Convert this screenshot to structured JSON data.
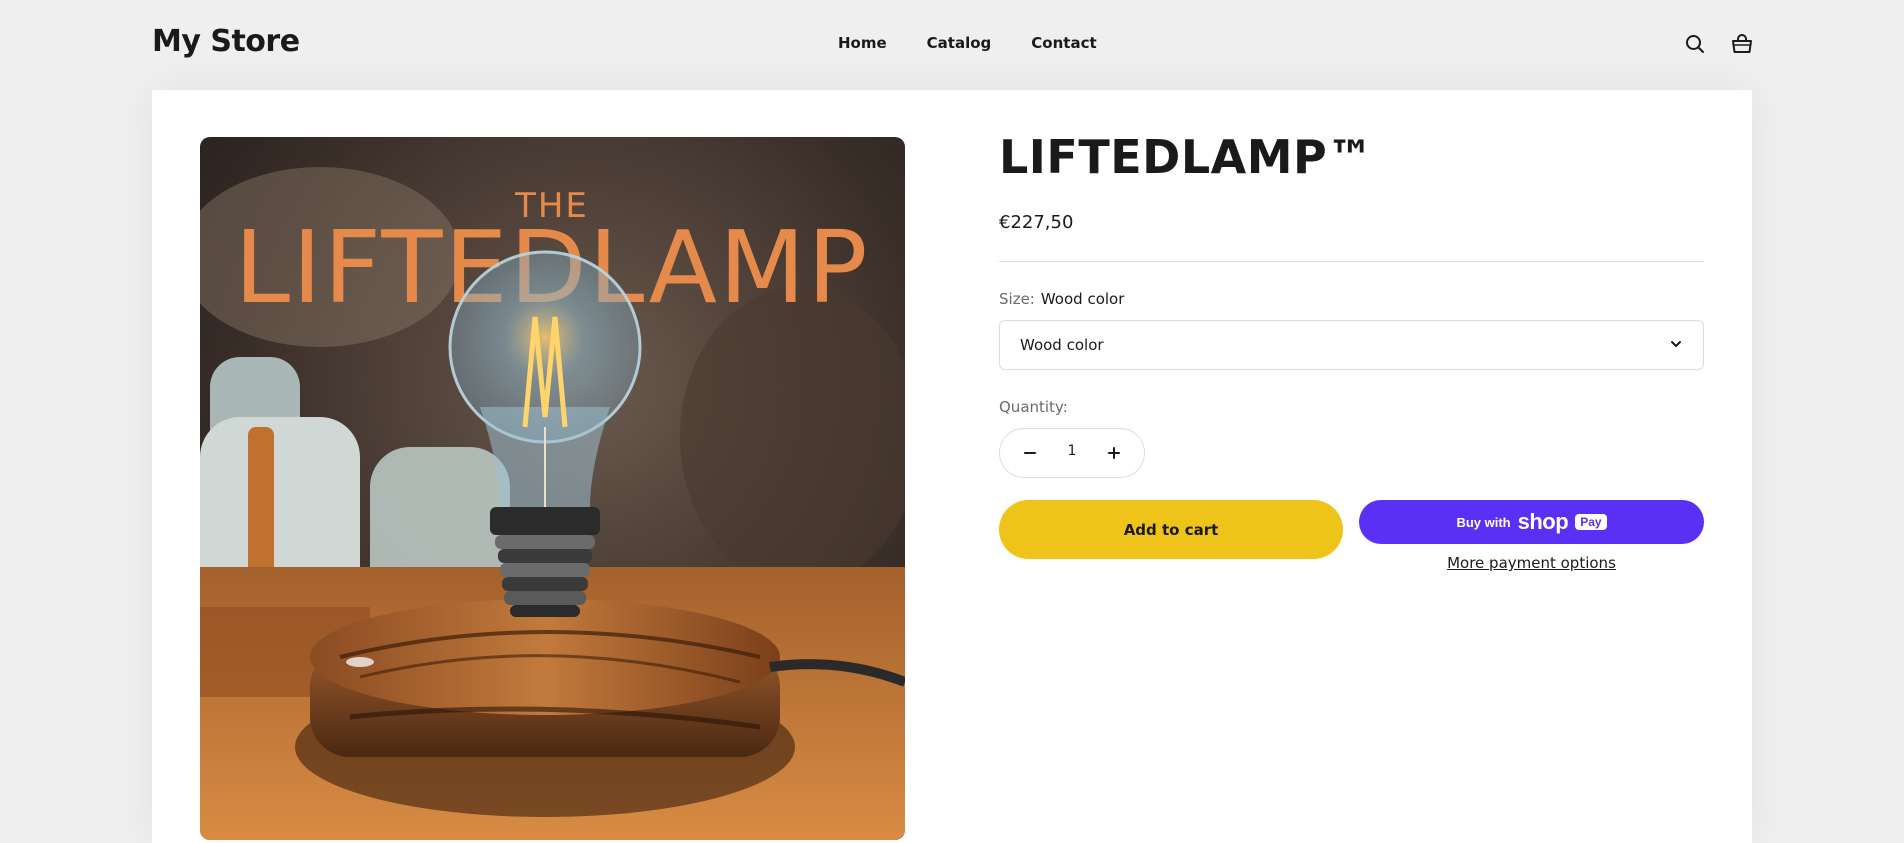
{
  "header": {
    "logo": "My Store",
    "nav": [
      {
        "label": "Home"
      },
      {
        "label": "Catalog"
      },
      {
        "label": "Contact"
      }
    ],
    "icons": [
      "search-icon",
      "cart-icon"
    ]
  },
  "product": {
    "image": {
      "headline_small": "THE",
      "headline_large": "LIFTEDLAMP"
    },
    "title": "LIFTEDLAMP™",
    "price": "€227,50",
    "size": {
      "label": "Size:",
      "selected": "Wood color",
      "select_value": "Wood color"
    },
    "quantity": {
      "label": "Quantity:",
      "value": "1"
    },
    "add_to_cart": "Add to cart",
    "shop_pay": {
      "prefix": "Buy with",
      "brand": "shop",
      "badge": "Pay"
    },
    "more_payment": "More payment options"
  },
  "colors": {
    "add_to_cart": "#eec31a",
    "shop_pay": "#5a31f4",
    "background": "#efefef"
  }
}
